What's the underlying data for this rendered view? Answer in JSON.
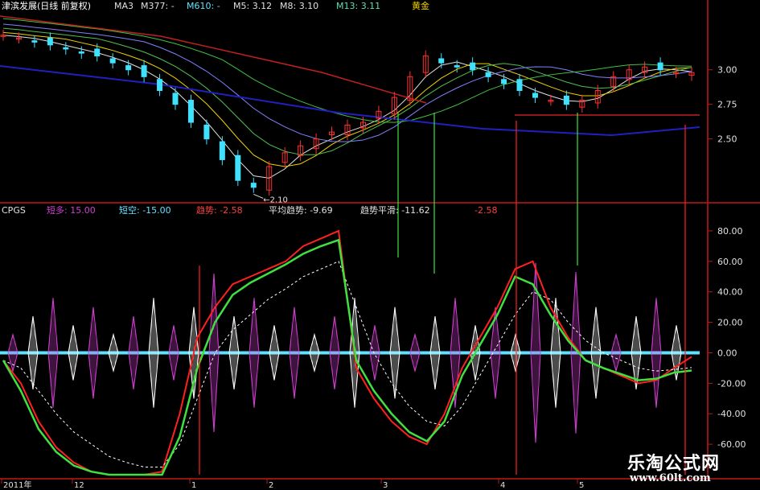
{
  "colors": {
    "bg": "#000000",
    "up": "#ff3030",
    "down": "#40e0ff",
    "axis": "#c01818",
    "short_long": "#d040d0",
    "short_short": "#60e0ff",
    "trend": "#ff2020",
    "avg_trend": "#ffffff",
    "trend_smooth": "#40e040",
    "ma_red": "#c02020",
    "ma_blue": "#2020c0",
    "ma_green": "#50c050"
  },
  "top_header": {
    "title": "津滨发展(日线 前复权)",
    "ma3": "MA3",
    "m377": "M377: -",
    "m610": "M610: -",
    "m5": "M5: 3.12",
    "m8": "M8: 3.10",
    "m13": "M13: 3.11",
    "extra": "黄金"
  },
  "indicator_header": {
    "name": "CPGS",
    "short_long": "短多: 15.00",
    "short_short": "短空: -15.00",
    "trend": "趋势: -2.58",
    "avg_trend": "平均趋势: -9.69",
    "trend_smooth": "趋势平滑: -11.62",
    "last": "-2.58",
    "arrow_up": "↑",
    "arrow_down": "↓"
  },
  "price_axis": {
    "ticks": [
      "3.00",
      "2.75",
      "2.50"
    ],
    "low_label": "2.10"
  },
  "indicator_axis": {
    "ticks": [
      "80.00",
      "60.00",
      "40.00",
      "20.00",
      "0.00",
      "-20.00",
      "-40.00",
      "-60.00"
    ]
  },
  "date_axis": {
    "ticks": [
      "2011年",
      "12",
      "1",
      "2",
      "3",
      "4",
      "5"
    ]
  },
  "watermark": {
    "cn": "乐淘公式网",
    "url": "www.60lt.com"
  },
  "chart_data": [
    {
      "type": "candlestick",
      "title": "津滨发展(日线 前复权)",
      "ylim": [
        2.05,
        3.4
      ],
      "x": [
        "2011年",
        "12",
        "1",
        "2",
        "3",
        "4",
        "5"
      ],
      "close_path": [
        3.25,
        3.23,
        3.2,
        3.18,
        3.15,
        3.12,
        3.1,
        3.05,
        3.0,
        2.95,
        2.85,
        2.75,
        2.62,
        2.5,
        2.35,
        2.2,
        2.15,
        2.3,
        2.4,
        2.45,
        2.5,
        2.55,
        2.6,
        2.62,
        2.7,
        2.8,
        2.95,
        3.1,
        3.05,
        3.02,
        3.0,
        2.95,
        2.9,
        2.85,
        2.8,
        2.78,
        2.75,
        2.78,
        2.85,
        2.95,
        3.0,
        3.02,
        3.0,
        2.98,
        2.98
      ],
      "low": 2.1
    },
    {
      "type": "line",
      "title": "CPGS",
      "ylim": [
        -80,
        90
      ],
      "series": [
        {
          "name": "趋势",
          "last": -2.58,
          "values": [
            -5,
            -20,
            -45,
            -62,
            -72,
            -78,
            -80,
            -82,
            -80,
            -78,
            -40,
            10,
            30,
            45,
            50,
            55,
            60,
            70,
            75,
            80,
            -10,
            -30,
            -45,
            -55,
            -60,
            -40,
            -10,
            10,
            30,
            55,
            60,
            30,
            10,
            -5,
            -10,
            -15,
            -20,
            -18,
            -10,
            -2.58
          ]
        },
        {
          "name": "平均趋势",
          "last": -9.69,
          "values": [
            -5,
            -10,
            -25,
            -40,
            -52,
            -60,
            -68,
            -72,
            -75,
            -75,
            -60,
            -30,
            0,
            15,
            25,
            35,
            42,
            50,
            55,
            60,
            30,
            0,
            -20,
            -35,
            -45,
            -48,
            -35,
            -15,
            5,
            25,
            40,
            35,
            20,
            8,
            0,
            -5,
            -10,
            -12,
            -11,
            -9.69
          ]
        },
        {
          "name": "趋势平滑",
          "last": -11.62,
          "values": [
            -5,
            -25,
            -50,
            -65,
            -74,
            -78,
            -80,
            -82,
            -82,
            -80,
            -55,
            -10,
            20,
            38,
            46,
            52,
            58,
            65,
            70,
            74,
            -5,
            -25,
            -40,
            -52,
            -58,
            -45,
            -15,
            5,
            25,
            50,
            45,
            25,
            8,
            -5,
            -10,
            -14,
            -18,
            -17,
            -13,
            -11.62
          ]
        },
        {
          "name": "短多",
          "last": 15.0
        },
        {
          "name": "短空",
          "last": -15.0
        }
      ]
    }
  ]
}
